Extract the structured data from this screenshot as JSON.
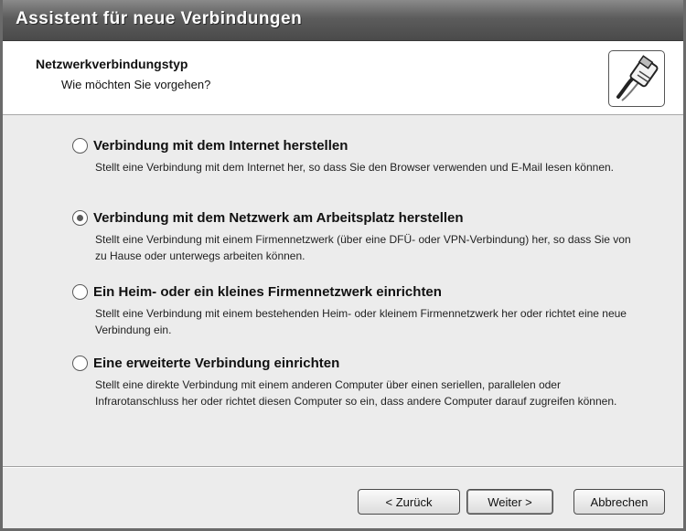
{
  "window": {
    "title": "Assistent für neue Verbindungen"
  },
  "header": {
    "heading": "Netzwerkverbindungstyp",
    "subheading": "Wie möchten Sie vorgehen?",
    "icon": "network-cable-icon"
  },
  "options": [
    {
      "label": "Verbindung mit dem Internet herstellen",
      "description": "Stellt eine Verbindung mit dem Internet her, so dass Sie den Browser verwenden und E-Mail lesen können.",
      "selected": false
    },
    {
      "label": "Verbindung mit dem Netzwerk am Arbeitsplatz herstellen",
      "description": "Stellt eine Verbindung mit einem Firmennetzwerk (über eine DFÜ- oder VPN-Verbindung) her, so dass Sie von zu Hause oder unterwegs arbeiten können.",
      "selected": true
    },
    {
      "label": "Ein Heim- oder ein kleines Firmennetzwerk einrichten",
      "description": "Stellt eine Verbindung mit einem bestehenden Heim- oder kleinem Firmennetzwerk her oder richtet eine neue Verbindung ein.",
      "selected": false
    },
    {
      "label": "Eine erweiterte Verbindung einrichten",
      "description": "Stellt eine direkte Verbindung mit einem anderen Computer über einen seriellen, parallelen oder Infrarotanschluss her oder richtet diesen Computer so ein, dass andere Computer darauf zugreifen können.",
      "selected": false
    }
  ],
  "buttons": {
    "back": "< Zurück",
    "next": "Weiter >",
    "cancel": "Abbrechen"
  }
}
